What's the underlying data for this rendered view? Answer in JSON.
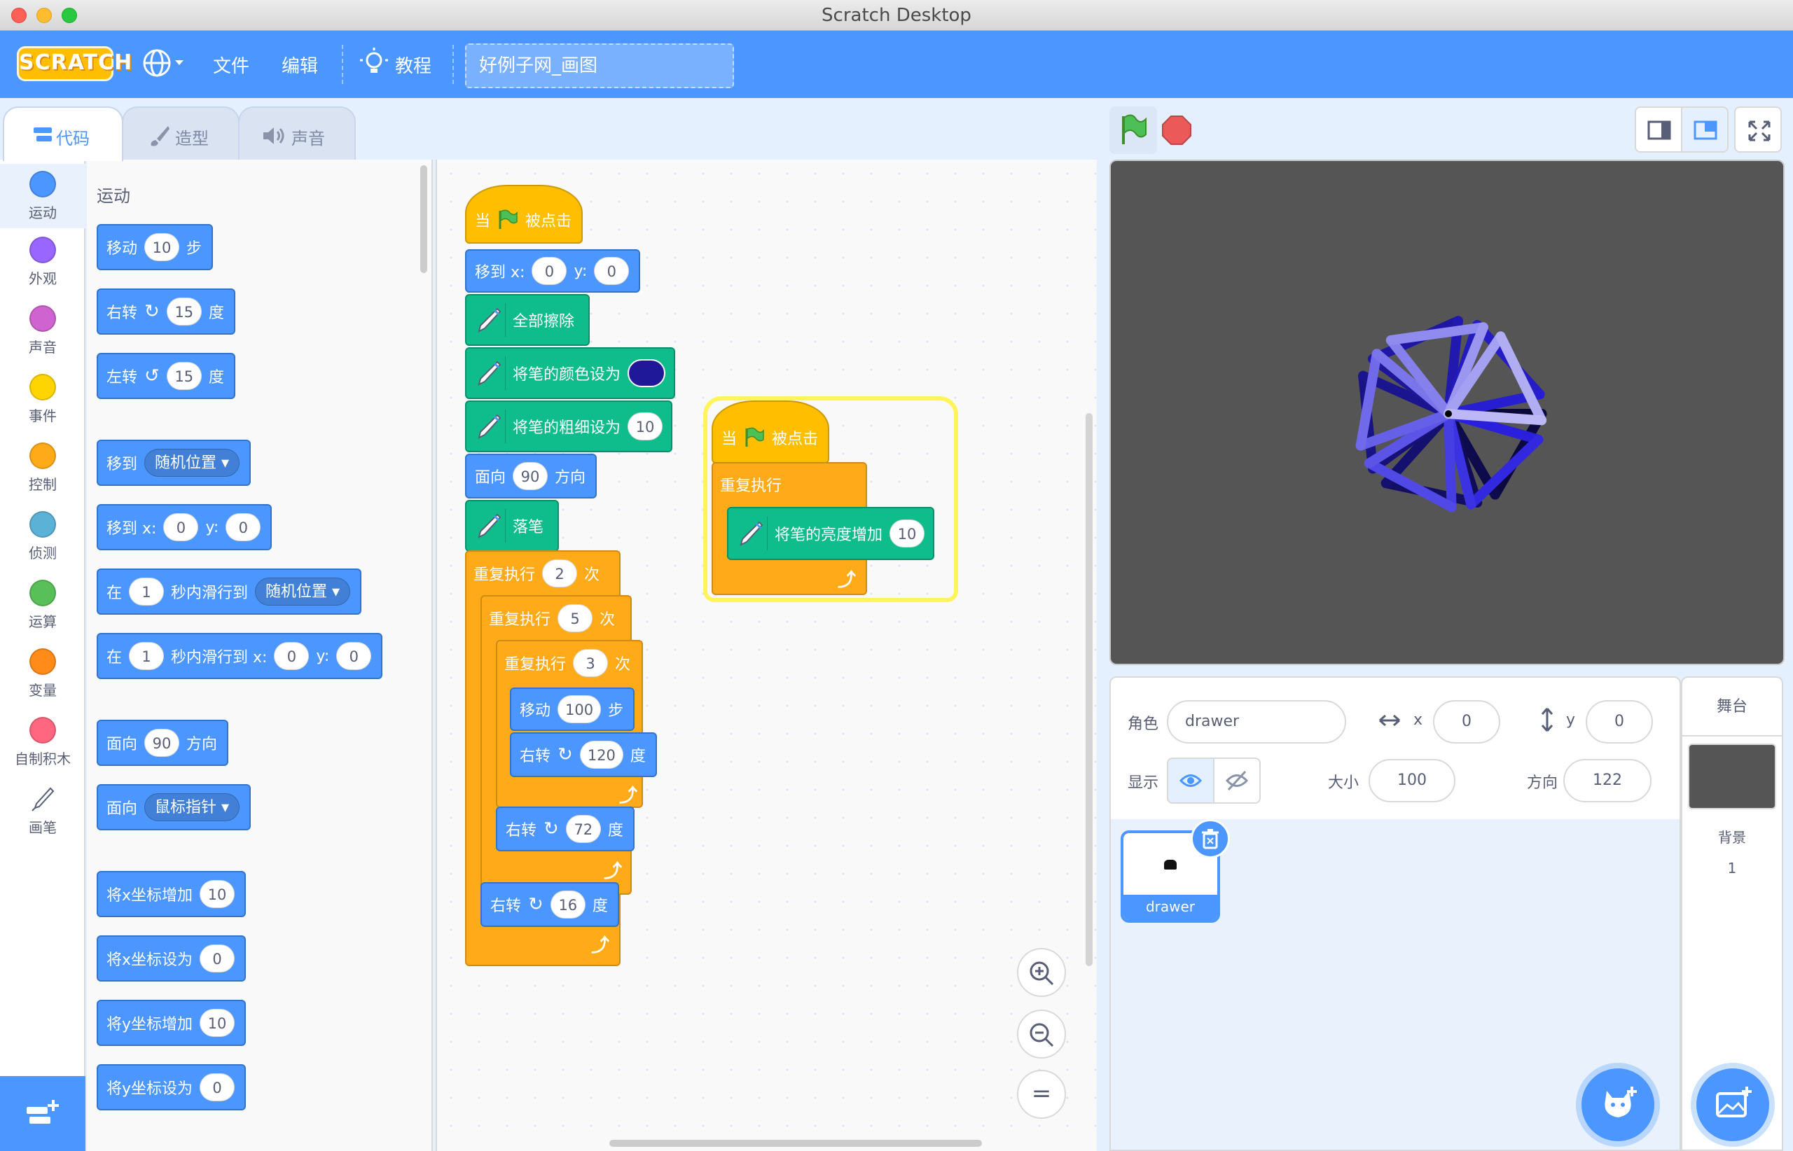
{
  "window": {
    "title": "Scratch Desktop"
  },
  "menubar": {
    "logo": "SCRATCH",
    "file": "文件",
    "edit": "编辑",
    "tutorials": "教程",
    "project_title": "好例子网_画图"
  },
  "tabs": {
    "code": "代码",
    "costumes": "造型",
    "sounds": "声音"
  },
  "categories": [
    {
      "label": "运动",
      "color": "#4c97ff"
    },
    {
      "label": "外观",
      "color": "#9966ff"
    },
    {
      "label": "声音",
      "color": "#cf63cf"
    },
    {
      "label": "事件",
      "color": "#ffd500"
    },
    {
      "label": "控制",
      "color": "#ffab19"
    },
    {
      "label": "侦测",
      "color": "#5cb1d6"
    },
    {
      "label": "运算",
      "color": "#59c059"
    },
    {
      "label": "变量",
      "color": "#ff8c1a"
    },
    {
      "label": "自制积木",
      "color": "#ff6680"
    },
    {
      "label": "画笔",
      "color": "#0fbd8c"
    }
  ],
  "palette": {
    "heading": "运动",
    "move": {
      "a": "移动",
      "v": "10",
      "b": "步"
    },
    "turn_right": {
      "a": "右转",
      "v": "15",
      "b": "度"
    },
    "turn_left": {
      "a": "左转",
      "v": "15",
      "b": "度"
    },
    "goto": {
      "a": "移到",
      "dd": "随机位置"
    },
    "goto_xy": {
      "a": "移到 x:",
      "x": "0",
      "b": "y:",
      "y": "0"
    },
    "glide": {
      "a": "在",
      "v": "1",
      "b": "秒内滑行到",
      "dd": "随机位置"
    },
    "glide_xy": {
      "a": "在",
      "v": "1",
      "b": "秒内滑行到 x:",
      "x": "0",
      "c": "y:",
      "y": "0"
    },
    "point": {
      "a": "面向",
      "v": "90",
      "b": "方向"
    },
    "point_towards": {
      "a": "面向",
      "dd": "鼠标指针"
    },
    "change_x": {
      "a": "将x坐标增加",
      "v": "10"
    },
    "set_x": {
      "a": "将x坐标设为",
      "v": "0"
    },
    "change_y": {
      "a": "将y坐标增加",
      "v": "10"
    },
    "set_y": {
      "a": "将y坐标设为",
      "v": "0"
    }
  },
  "script1": {
    "hat": {
      "a": "当",
      "b": "被点击"
    },
    "goto": {
      "a": "移到 x:",
      "x": "0",
      "b": "y:",
      "y": "0"
    },
    "clear": "全部擦除",
    "set_color": "将笔的颜色设为",
    "set_color_value": "#1f1899",
    "set_size": {
      "a": "将笔的粗细设为",
      "v": "10"
    },
    "point": {
      "a": "面向",
      "v": "90",
      "b": "方向"
    },
    "pen_down": "落笔",
    "repeat1": {
      "a": "重复执行",
      "v": "2",
      "b": "次"
    },
    "repeat2": {
      "a": "重复执行",
      "v": "5",
      "b": "次"
    },
    "repeat3": {
      "a": "重复执行",
      "v": "3",
      "b": "次"
    },
    "move": {
      "a": "移动",
      "v": "100",
      "b": "步"
    },
    "turn120": {
      "a": "右转",
      "v": "120",
      "b": "度"
    },
    "turn72": {
      "a": "右转",
      "v": "72",
      "b": "度"
    },
    "turn16": {
      "a": "右转",
      "v": "16",
      "b": "度"
    }
  },
  "script2": {
    "hat": {
      "a": "当",
      "b": "被点击"
    },
    "forever": "重复执行",
    "change_brightness": {
      "a": "将笔的亮度增加",
      "v": "10"
    }
  },
  "zoom": {
    "in": "+",
    "out": "−",
    "reset": "="
  },
  "sprite_info": {
    "sprite_label": "角色",
    "sprite_name": "drawer",
    "x_label": "x",
    "x": "0",
    "y_label": "y",
    "y": "0",
    "show_label": "显示",
    "size_label": "大小",
    "size": "100",
    "direction_label": "方向",
    "direction": "122"
  },
  "sprites": [
    {
      "name": "drawer"
    }
  ],
  "stage_pane": {
    "title": "舞台",
    "backdrops_label": "背景",
    "backdrops_count": "1"
  },
  "colors": {
    "accent": "#4c97ff",
    "menubar": "#4c97ff"
  }
}
